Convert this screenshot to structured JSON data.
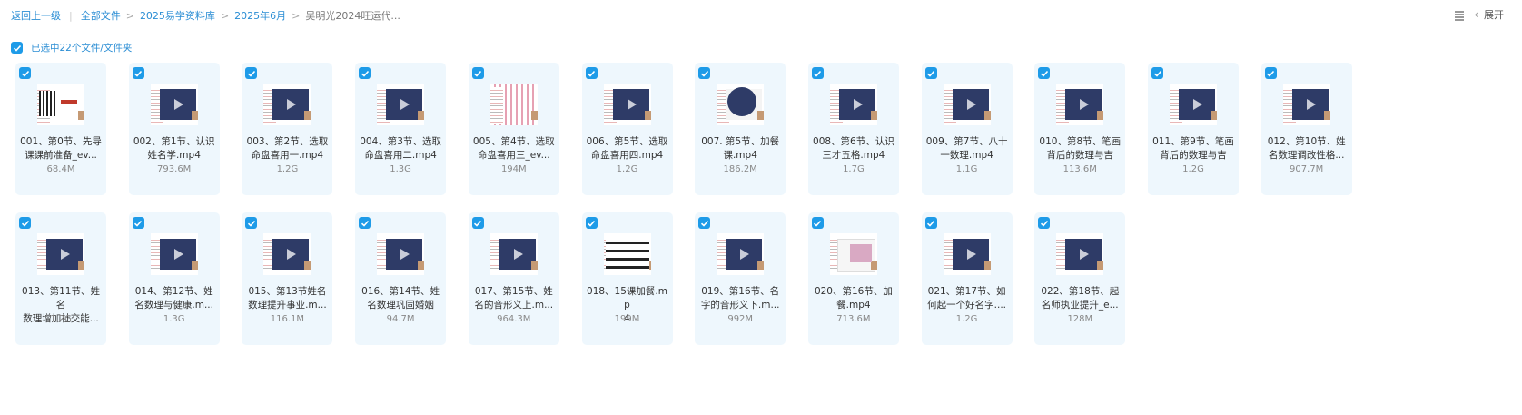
{
  "breadcrumb": {
    "back": "返回上一级",
    "items": [
      "全部文件",
      "2025易学资料库",
      "2025年6月"
    ],
    "current": "吴明光2024旺运代..."
  },
  "toolbar": {
    "view_icon": "list-view-icon",
    "expand_label": "展开"
  },
  "selection": {
    "label": "已选中22个文件/文件夹"
  },
  "accent": "#1e9be8",
  "files": [
    {
      "line1": "001、第0节、先导",
      "line2": "课课前准备_ev...",
      "size": "68.4M",
      "thumb": "qr"
    },
    {
      "line1": "002、第1节、认识",
      "line2": "姓名学.mp4",
      "size": "793.6M",
      "thumb": "video"
    },
    {
      "line1": "003、第2节、选取",
      "line2": "命盘喜用一.mp4",
      "size": "1.2G",
      "thumb": "video"
    },
    {
      "line1": "004、第3节、选取",
      "line2": "命盘喜用二.mp4",
      "size": "1.3G",
      "thumb": "video"
    },
    {
      "line1": "005、第4节、选取",
      "line2": "命盘喜用三_ev...",
      "size": "194M",
      "thumb": "grid"
    },
    {
      "line1": "006、第5节、选取",
      "line2": "命盘喜用四.mp4",
      "size": "1.2G",
      "thumb": "video"
    },
    {
      "line1": "007. 第5节、加餐",
      "line2": "课.mp4",
      "size": "186.2M",
      "thumb": "round"
    },
    {
      "line1": "008、第6节、认识",
      "line2": "三才五格.mp4",
      "size": "1.7G",
      "thumb": "video"
    },
    {
      "line1": "009、第7节、八十",
      "line2": "一数理.mp4",
      "size": "1.1G",
      "thumb": "video"
    },
    {
      "line1": "010、第8节、笔画",
      "line2": "背后的数理与吉",
      "size": "113.6M",
      "thumb": "video"
    },
    {
      "line1": "011、第9节、笔画",
      "line2": "背后的数理与吉",
      "size": "1.2G",
      "thumb": "video"
    },
    {
      "line1": "012、第10节、姓",
      "line2": "名数理调改性格...",
      "size": "907.7M",
      "thumb": "video"
    },
    {
      "line1": "013、第11节、姓名",
      "line2": "数理增加社交能...",
      "size": "1.2G",
      "thumb": "video"
    },
    {
      "line1": "014、第12节、姓",
      "line2": "名数理与健康.m...",
      "size": "1.3G",
      "thumb": "video"
    },
    {
      "line1": "015、第13节姓名",
      "line2": "数理提升事业.m...",
      "size": "116.1M",
      "thumb": "video"
    },
    {
      "line1": "016、第14节、姓",
      "line2": "名数理巩固婚姻",
      "size": "94.7M",
      "thumb": "video"
    },
    {
      "line1": "017、第15节、姓",
      "line2": "名的音形义上.m...",
      "size": "964.3M",
      "thumb": "video"
    },
    {
      "line1": "018、15课加餐.mp",
      "line2": "4",
      "size": "199M",
      "thumb": "text"
    },
    {
      "line1": "019、第16节、名",
      "line2": "字的音形义下.m...",
      "size": "992M",
      "thumb": "video"
    },
    {
      "line1": "020、第16节、加",
      "line2": "餐.mp4",
      "size": "713.6M",
      "thumb": "doc"
    },
    {
      "line1": "021、第17节、如",
      "line2": "何起一个好名字....",
      "size": "1.2G",
      "thumb": "video"
    },
    {
      "line1": "022、第18节、起",
      "line2": "名师执业提升_e...",
      "size": "128M",
      "thumb": "video"
    }
  ]
}
